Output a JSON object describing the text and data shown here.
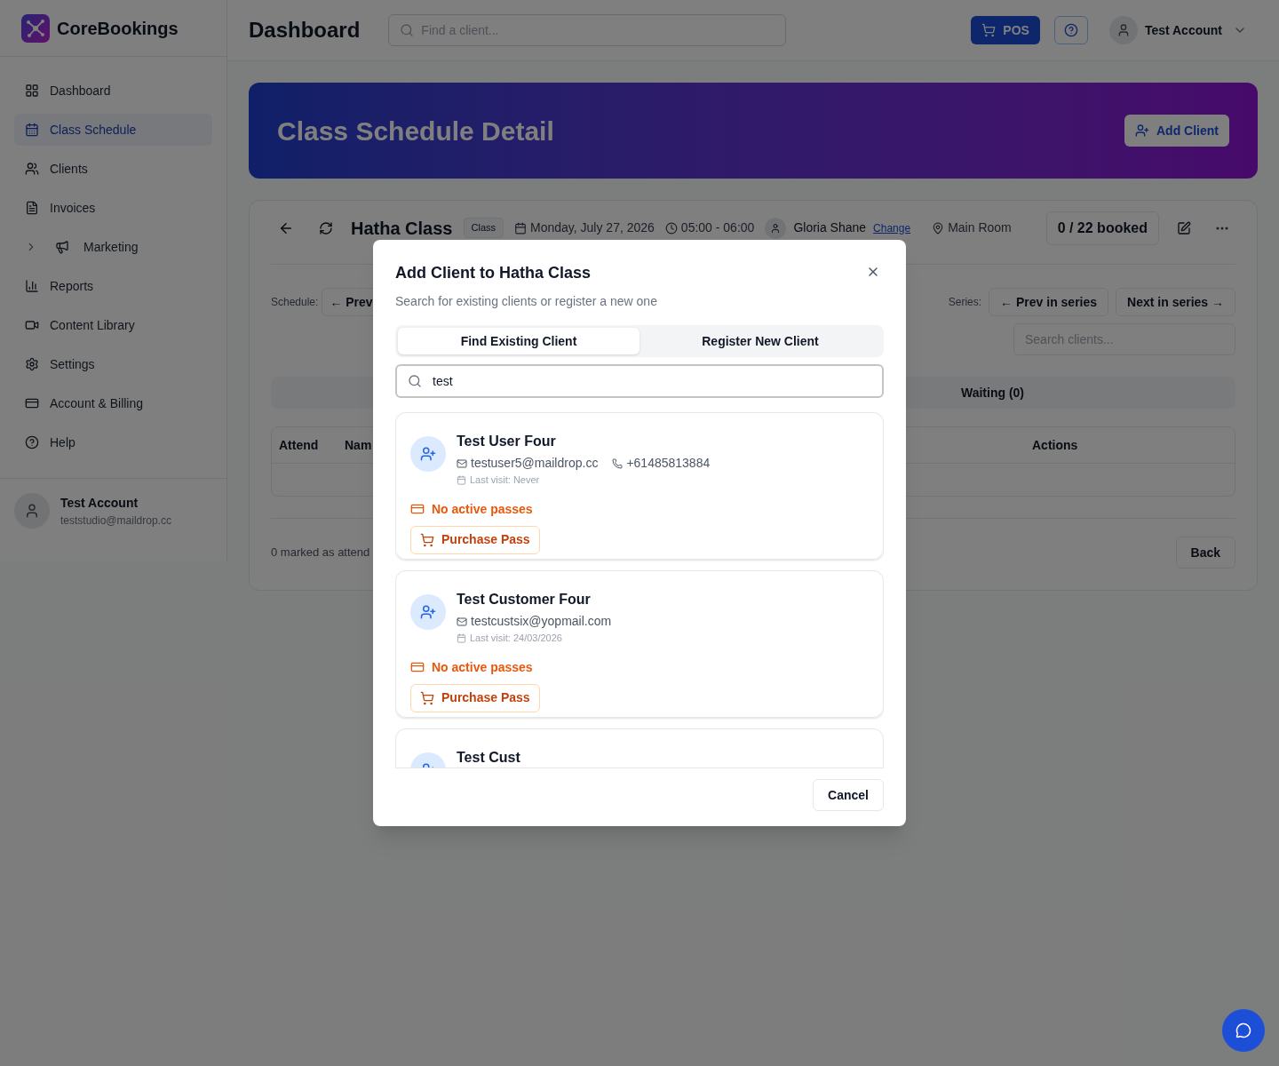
{
  "brand": {
    "name": "CoreBookings"
  },
  "sidebar": {
    "items": [
      {
        "label": "Dashboard",
        "selected": false
      },
      {
        "label": "Class Schedule",
        "selected": true
      },
      {
        "label": "Clients",
        "selected": false
      },
      {
        "label": "Invoices",
        "selected": false
      },
      {
        "label": "Marketing",
        "selected": false,
        "expanded": false,
        "kind": "group"
      },
      {
        "label": "Reports",
        "selected": false
      },
      {
        "label": "Content Library",
        "selected": false
      },
      {
        "label": "Settings",
        "selected": false
      },
      {
        "label": "Account & Billing",
        "selected": false
      },
      {
        "label": "Help",
        "selected": false
      }
    ],
    "user": {
      "name": "Test Account",
      "email": "teststudio@maildrop.cc"
    }
  },
  "header": {
    "title": "Dashboard",
    "search_placeholder": "Find a client...",
    "pos": "POS",
    "account": "Test Account"
  },
  "banner": {
    "title": "Class Schedule Detail",
    "button": "Add Client"
  },
  "class": {
    "title": "Hatha Class",
    "badge": "Class",
    "date": "Monday, July 27, 2026",
    "time": "05:00 - 06:00",
    "instructor": "Gloria Shane",
    "change": "Change",
    "room": "Main Room",
    "booked": "0 / 22 booked"
  },
  "nav": {
    "schedule_label": "Schedule:",
    "prev": "← Prev",
    "series_label": "Series:",
    "prev_series": "← Prev in series",
    "next_series": "Next in series →"
  },
  "clients_search": {
    "placeholder": "Search clients..."
  },
  "list_tabs": [
    "Waiting (0)"
  ],
  "table": {
    "columns": [
      "Attend",
      "Nam",
      "Actions"
    ]
  },
  "footer": {
    "summary": "0 marked as attend",
    "back": "Back"
  },
  "modal": {
    "title": "Add Client to Hatha Class",
    "subtitle": "Search for existing clients or register a new one",
    "tabs": [
      {
        "label": "Find Existing Client",
        "selected": true
      },
      {
        "label": "Register New Client",
        "selected": false
      }
    ],
    "search": {
      "value": "test"
    },
    "clients": [
      {
        "name": "Test User Four",
        "email": "testuser5@maildrop.cc",
        "phone": "+61485813884",
        "last_visit": "Last visit: Never",
        "passes": "No active passes",
        "action": "Purchase Pass"
      },
      {
        "name": "Test Customer Four",
        "email": "testcustsix@yopmail.com",
        "last_visit": "Last visit: 24/03/2026",
        "passes": "No active passes",
        "action": "Purchase Pass"
      },
      {
        "name": "Test Cust"
      }
    ],
    "cancel": "Cancel"
  }
}
